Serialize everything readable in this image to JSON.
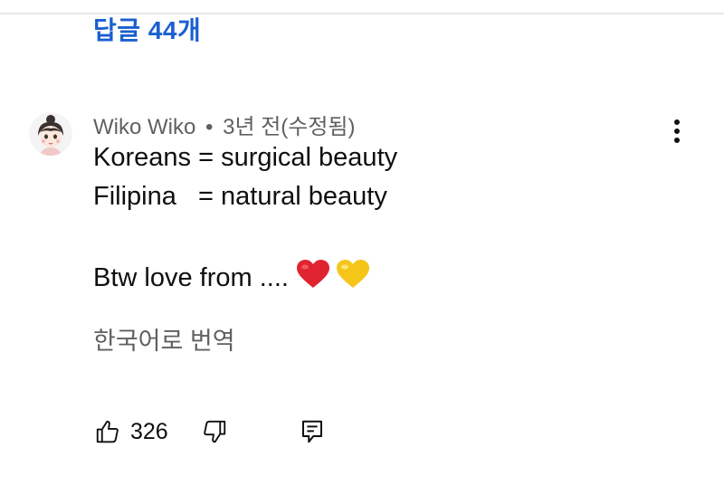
{
  "replies": {
    "label": "답글 44개"
  },
  "comment": {
    "author": "Wiko Wiko",
    "separator": "•",
    "timestamp": "3년 전(수정됨)",
    "lines": [
      "Koreans = surgical beauty",
      "Filipina   = natural beauty",
      "",
      "Btw love from .... "
    ],
    "translate_label": "한국어로 번역"
  },
  "actions": {
    "like_count": "326"
  },
  "icons": {
    "avatar": "cartoon-girl-avatar",
    "more": "vertical-ellipsis-icon",
    "like": "thumbs-up-icon",
    "dislike": "thumbs-down-icon",
    "reply": "reply-comment-icon",
    "heart_red": "red-heart-emoji",
    "heart_yellow": "yellow-heart-emoji"
  },
  "colors": {
    "link": "#1a5fd0",
    "meta": "#606060",
    "text": "#0f0f0f"
  }
}
